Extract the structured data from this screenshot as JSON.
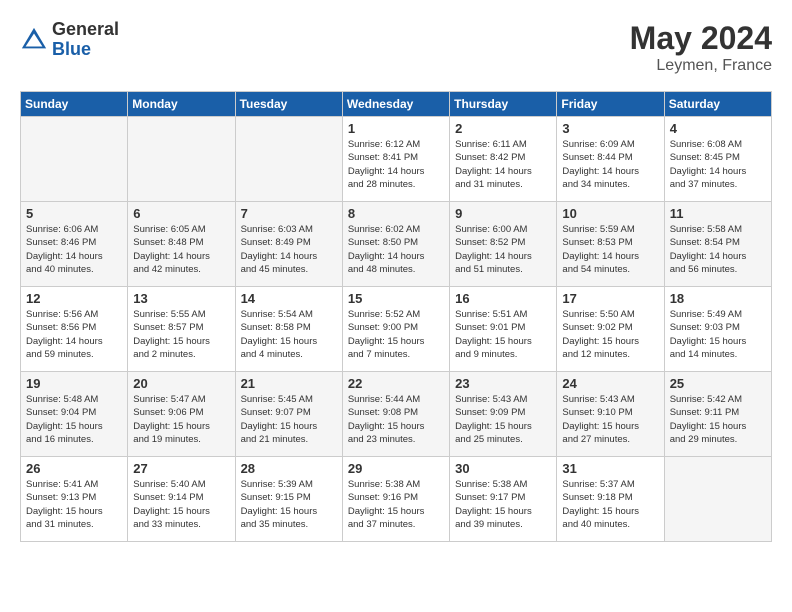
{
  "header": {
    "logo_general": "General",
    "logo_blue": "Blue",
    "month_year": "May 2024",
    "location": "Leymen, France"
  },
  "weekdays": [
    "Sunday",
    "Monday",
    "Tuesday",
    "Wednesday",
    "Thursday",
    "Friday",
    "Saturday"
  ],
  "weeks": [
    [
      {
        "day": "",
        "empty": true
      },
      {
        "day": "",
        "empty": true
      },
      {
        "day": "",
        "empty": true
      },
      {
        "day": "1",
        "info": "Sunrise: 6:12 AM\nSunset: 8:41 PM\nDaylight: 14 hours\nand 28 minutes."
      },
      {
        "day": "2",
        "info": "Sunrise: 6:11 AM\nSunset: 8:42 PM\nDaylight: 14 hours\nand 31 minutes."
      },
      {
        "day": "3",
        "info": "Sunrise: 6:09 AM\nSunset: 8:44 PM\nDaylight: 14 hours\nand 34 minutes."
      },
      {
        "day": "4",
        "info": "Sunrise: 6:08 AM\nSunset: 8:45 PM\nDaylight: 14 hours\nand 37 minutes."
      }
    ],
    [
      {
        "day": "5",
        "info": "Sunrise: 6:06 AM\nSunset: 8:46 PM\nDaylight: 14 hours\nand 40 minutes."
      },
      {
        "day": "6",
        "info": "Sunrise: 6:05 AM\nSunset: 8:48 PM\nDaylight: 14 hours\nand 42 minutes."
      },
      {
        "day": "7",
        "info": "Sunrise: 6:03 AM\nSunset: 8:49 PM\nDaylight: 14 hours\nand 45 minutes."
      },
      {
        "day": "8",
        "info": "Sunrise: 6:02 AM\nSunset: 8:50 PM\nDaylight: 14 hours\nand 48 minutes."
      },
      {
        "day": "9",
        "info": "Sunrise: 6:00 AM\nSunset: 8:52 PM\nDaylight: 14 hours\nand 51 minutes."
      },
      {
        "day": "10",
        "info": "Sunrise: 5:59 AM\nSunset: 8:53 PM\nDaylight: 14 hours\nand 54 minutes."
      },
      {
        "day": "11",
        "info": "Sunrise: 5:58 AM\nSunset: 8:54 PM\nDaylight: 14 hours\nand 56 minutes."
      }
    ],
    [
      {
        "day": "12",
        "info": "Sunrise: 5:56 AM\nSunset: 8:56 PM\nDaylight: 14 hours\nand 59 minutes."
      },
      {
        "day": "13",
        "info": "Sunrise: 5:55 AM\nSunset: 8:57 PM\nDaylight: 15 hours\nand 2 minutes."
      },
      {
        "day": "14",
        "info": "Sunrise: 5:54 AM\nSunset: 8:58 PM\nDaylight: 15 hours\nand 4 minutes."
      },
      {
        "day": "15",
        "info": "Sunrise: 5:52 AM\nSunset: 9:00 PM\nDaylight: 15 hours\nand 7 minutes."
      },
      {
        "day": "16",
        "info": "Sunrise: 5:51 AM\nSunset: 9:01 PM\nDaylight: 15 hours\nand 9 minutes."
      },
      {
        "day": "17",
        "info": "Sunrise: 5:50 AM\nSunset: 9:02 PM\nDaylight: 15 hours\nand 12 minutes."
      },
      {
        "day": "18",
        "info": "Sunrise: 5:49 AM\nSunset: 9:03 PM\nDaylight: 15 hours\nand 14 minutes."
      }
    ],
    [
      {
        "day": "19",
        "info": "Sunrise: 5:48 AM\nSunset: 9:04 PM\nDaylight: 15 hours\nand 16 minutes."
      },
      {
        "day": "20",
        "info": "Sunrise: 5:47 AM\nSunset: 9:06 PM\nDaylight: 15 hours\nand 19 minutes."
      },
      {
        "day": "21",
        "info": "Sunrise: 5:45 AM\nSunset: 9:07 PM\nDaylight: 15 hours\nand 21 minutes."
      },
      {
        "day": "22",
        "info": "Sunrise: 5:44 AM\nSunset: 9:08 PM\nDaylight: 15 hours\nand 23 minutes."
      },
      {
        "day": "23",
        "info": "Sunrise: 5:43 AM\nSunset: 9:09 PM\nDaylight: 15 hours\nand 25 minutes."
      },
      {
        "day": "24",
        "info": "Sunrise: 5:43 AM\nSunset: 9:10 PM\nDaylight: 15 hours\nand 27 minutes."
      },
      {
        "day": "25",
        "info": "Sunrise: 5:42 AM\nSunset: 9:11 PM\nDaylight: 15 hours\nand 29 minutes."
      }
    ],
    [
      {
        "day": "26",
        "info": "Sunrise: 5:41 AM\nSunset: 9:13 PM\nDaylight: 15 hours\nand 31 minutes."
      },
      {
        "day": "27",
        "info": "Sunrise: 5:40 AM\nSunset: 9:14 PM\nDaylight: 15 hours\nand 33 minutes."
      },
      {
        "day": "28",
        "info": "Sunrise: 5:39 AM\nSunset: 9:15 PM\nDaylight: 15 hours\nand 35 minutes."
      },
      {
        "day": "29",
        "info": "Sunrise: 5:38 AM\nSunset: 9:16 PM\nDaylight: 15 hours\nand 37 minutes."
      },
      {
        "day": "30",
        "info": "Sunrise: 5:38 AM\nSunset: 9:17 PM\nDaylight: 15 hours\nand 39 minutes."
      },
      {
        "day": "31",
        "info": "Sunrise: 5:37 AM\nSunset: 9:18 PM\nDaylight: 15 hours\nand 40 minutes."
      },
      {
        "day": "",
        "empty": true
      }
    ]
  ]
}
